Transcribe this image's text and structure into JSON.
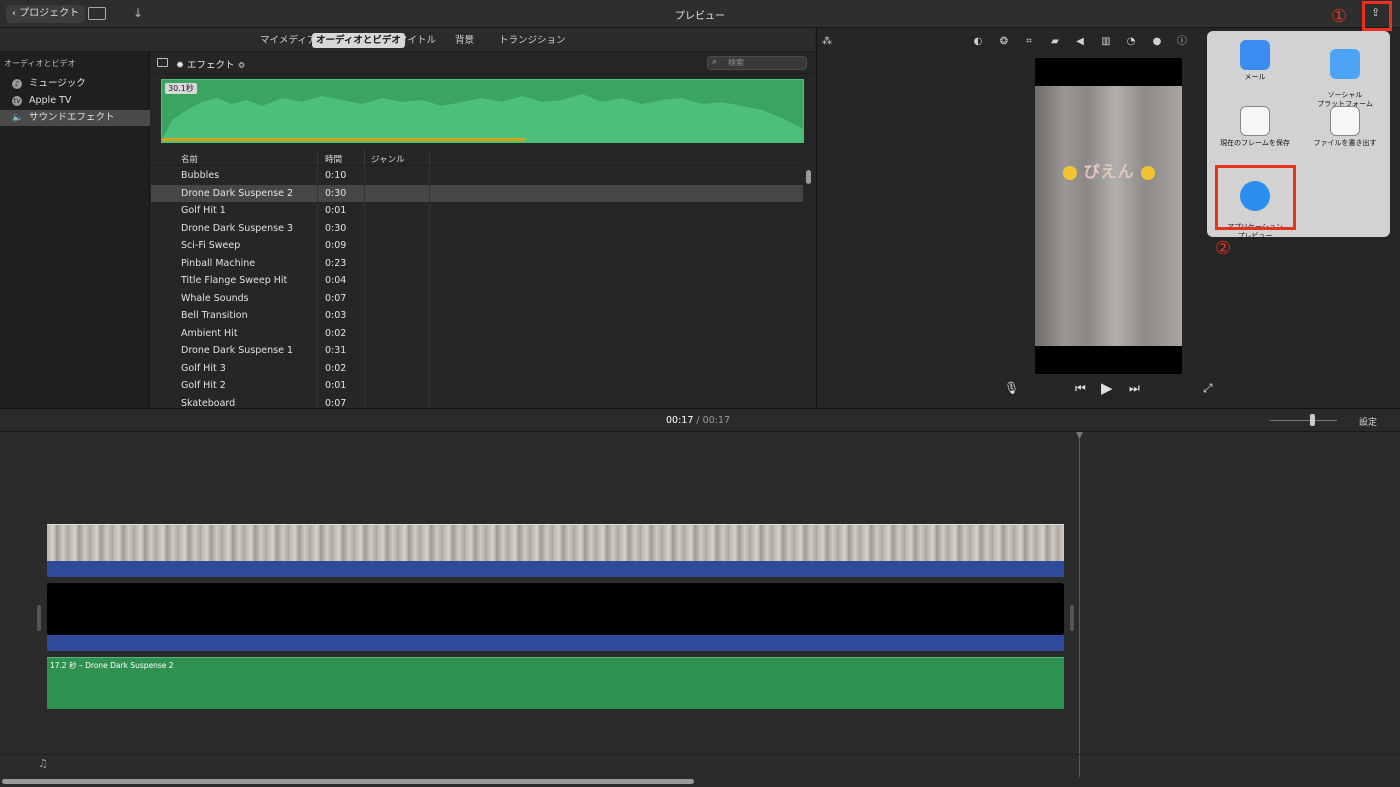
{
  "toolbar": {
    "back_label": "プロジェクト",
    "title": "プレビュー"
  },
  "tabs": [
    "マイメディア",
    "オーディオとビデオ",
    "タイトル",
    "背景",
    "トランジション"
  ],
  "sidebar": {
    "heading": "オーディオとビデオ",
    "items": [
      {
        "label": "ミュージック",
        "icon": "music-icon"
      },
      {
        "label": "Apple TV",
        "icon": "appletv-icon"
      },
      {
        "label": "サウンドエフェクト",
        "icon": "speaker-icon"
      }
    ]
  },
  "browser": {
    "category_label": "エフェクト ≎",
    "search_placeholder": "検索",
    "waveform_duration": "30.1秒",
    "columns": [
      "名前",
      "時間",
      "ジャンル"
    ],
    "rows": [
      {
        "name": "Bubbles",
        "time": "0:10"
      },
      {
        "name": "Drone Dark Suspense 2",
        "time": "0:30"
      },
      {
        "name": "Golf Hit 1",
        "time": "0:01"
      },
      {
        "name": "Drone Dark Suspense 3",
        "time": "0:30"
      },
      {
        "name": "Sci-Fi Sweep",
        "time": "0:09"
      },
      {
        "name": "Pinball Machine",
        "time": "0:23"
      },
      {
        "name": "Title Flange Sweep Hit",
        "time": "0:04"
      },
      {
        "name": "Whale Sounds",
        "time": "0:07"
      },
      {
        "name": "Bell Transition",
        "time": "0:03"
      },
      {
        "name": "Ambient Hit",
        "time": "0:02"
      },
      {
        "name": "Drone Dark Suspense 1",
        "time": "0:31"
      },
      {
        "name": "Golf Hit 3",
        "time": "0:02"
      },
      {
        "name": "Golf Hit 2",
        "time": "0:01"
      },
      {
        "name": "Skateboard",
        "time": "0:07"
      }
    ]
  },
  "viewer": {
    "sticker_text": "ぴえん"
  },
  "share": {
    "items": [
      {
        "label": "メール",
        "icon": "mail-icon"
      },
      {
        "label": "ソーシャル\nプラットフォーム",
        "icon": "social-icon"
      },
      {
        "label": "現在のフレームを保存",
        "icon": "photo-icon"
      },
      {
        "label": "ファイルを書き出す",
        "icon": "film-icon"
      },
      {
        "label": "アプリケーション\nプレビュー",
        "icon": "appstore-icon"
      }
    ],
    "annotation_1": "①",
    "annotation_2": "②"
  },
  "timeline": {
    "current_time": "00:17",
    "separator": "/",
    "total_time": "00:17",
    "settings_label": "設定",
    "audio_clip_label": "17.2 秒 – Drone Dark Suspense 2"
  }
}
